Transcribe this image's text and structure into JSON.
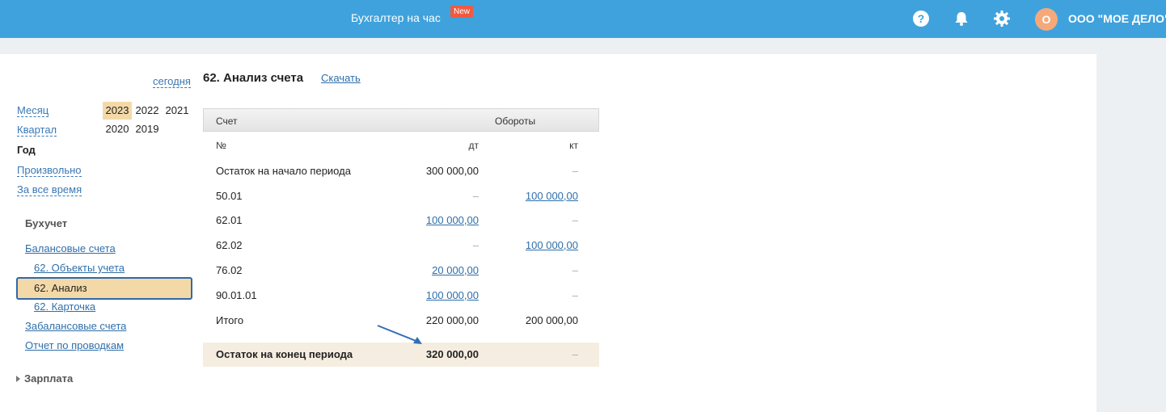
{
  "topbar": {
    "promo_label": "Бухгалтер на час",
    "new_badge": "New",
    "avatar_letter": "О",
    "company_name": "ООО \"МОЕ ДЕЛО\"",
    "color": "#3fa2dd"
  },
  "sidebar": {
    "today_link": "сегодня",
    "periods": {
      "month": "Месяц",
      "quarter": "Квартал",
      "year": "Год",
      "custom": "Произвольно",
      "all_time": "За все время"
    },
    "years_row1": [
      "2023",
      "2022",
      "2021"
    ],
    "years_row2": [
      "2020",
      "2019"
    ],
    "selected_year": "2023",
    "section_title": "Бухучет",
    "nav": {
      "balance_accounts": "Балансовые счета",
      "objects": "62. Объекты учета",
      "analysis": "62. Анализ",
      "card": "62. Карточка",
      "offbalance": "Забалансовые счета",
      "postings": "Отчет по проводкам"
    },
    "salary": "Зарплата"
  },
  "main": {
    "title": "62. Анализ счета",
    "download": "Скачать",
    "table": {
      "header_account": "Счет",
      "header_turnover": "Обороты",
      "sub_no": "№",
      "sub_dt": "дт",
      "sub_kt": "кт",
      "rows": [
        {
          "name": "Остаток на начало периода",
          "dt": "300 000,00",
          "kt": "–"
        },
        {
          "name": "50.01",
          "dt": "–",
          "kt": "100 000,00"
        },
        {
          "name": "62.01",
          "dt": "100 000,00",
          "kt": "–"
        },
        {
          "name": "62.02",
          "dt": "–",
          "kt": "100 000,00"
        },
        {
          "name": "76.02",
          "dt": "20 000,00",
          "kt": "–"
        },
        {
          "name": "90.01.01",
          "dt": "100 000,00",
          "kt": "–"
        },
        {
          "name": "Итого",
          "dt": "220 000,00",
          "kt": "200 000,00"
        }
      ],
      "final_row": {
        "name": "Остаток на конец периода",
        "dt": "320 000,00",
        "kt": "–"
      }
    }
  }
}
